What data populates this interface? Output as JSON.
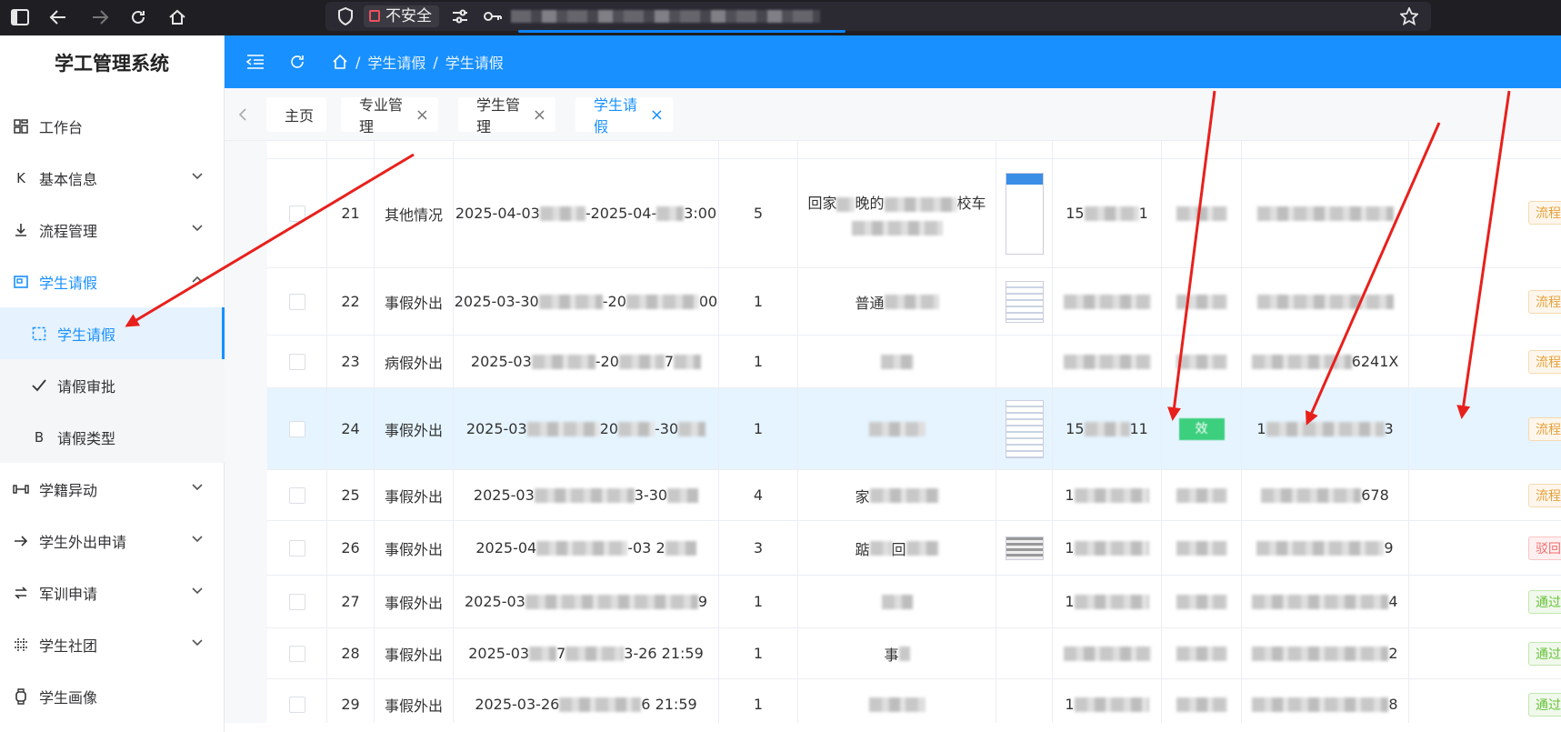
{
  "browser": {
    "security_label": "不安全"
  },
  "sidebar": {
    "app_title": "学工管理系统",
    "items": [
      {
        "label": "工作台"
      },
      {
        "label": "基本信息"
      },
      {
        "label": "流程管理"
      },
      {
        "label": "学生请假"
      },
      {
        "label": "学生请假"
      },
      {
        "label": "请假审批"
      },
      {
        "label": "请假类型"
      },
      {
        "label": "学籍异动"
      },
      {
        "label": "学生外出申请"
      },
      {
        "label": "军训申请"
      },
      {
        "label": "学生社团"
      },
      {
        "label": "学生画像"
      }
    ]
  },
  "header": {
    "breadcrumb": [
      "学生请假",
      "学生请假"
    ],
    "breadcrumb_sep": "/"
  },
  "tabs": [
    {
      "label": "主页"
    },
    {
      "label": "专业管理",
      "close": "×"
    },
    {
      "label": "学生管理",
      "close": "×"
    },
    {
      "label": "学生请假",
      "close": "×"
    }
  ],
  "table": {
    "rows": [
      {
        "no": "21",
        "type": "其他情况",
        "time_a": "2025-04-03",
        "time_b": "-2025-04-",
        "time_c": "3:00",
        "days": "5",
        "reason": "回家",
        "reason2": "晚的",
        "reason3": "校车",
        "phone": "15",
        "phone2": "1",
        "id_tail": "",
        "tag": "流程"
      },
      {
        "no": "22",
        "type": "事假外出",
        "time_a": "2025-03-30",
        "time_b": "-20",
        "time_c": "00",
        "days": "1",
        "reason": "普通",
        "reason2": "",
        "reason3": "",
        "phone": "",
        "phone2": "",
        "id_tail": "",
        "tag": "流程"
      },
      {
        "no": "23",
        "type": "病假外出",
        "time_a": "2025-03",
        "time_b": "-20",
        "time_c": "7",
        "days": "1",
        "reason": "",
        "reason2": "",
        "reason3": "",
        "phone": "",
        "phone2": "",
        "id_tail": "6241X",
        "tag": "流程"
      },
      {
        "no": "24",
        "type": "事假外出",
        "time_a": "2025-03",
        "time_b": "20",
        "time_c": "-30",
        "days": "1",
        "reason": "",
        "reason2": "",
        "reason3": "",
        "phone": "15",
        "phone2": "11",
        "id_tail": "3",
        "id_head": "1",
        "tag": "流程",
        "badge": "效"
      },
      {
        "no": "25",
        "type": "事假外出",
        "time_a": "2025-03",
        "time_b": "3-30",
        "time_c": "",
        "days": "4",
        "reason": "家",
        "reason2": "",
        "reason3": "",
        "phone": "1",
        "phone2": "",
        "id_tail": "678",
        "tag": "流程"
      },
      {
        "no": "26",
        "type": "事假外出",
        "time_a": "2025-04",
        "time_b": "-03 2",
        "time_c": "",
        "days": "3",
        "reason": "踮",
        "reason2": "回",
        "reason3": "",
        "phone": "1",
        "phone2": "",
        "id_tail": "9",
        "tag": "驳回"
      },
      {
        "no": "27",
        "type": "事假外出",
        "time_a": "2025-03",
        "time_b": "9",
        "time_c": "",
        "days": "1",
        "reason": "",
        "reason2": "",
        "reason3": "",
        "phone": "1",
        "phone2": "",
        "id_tail": "4",
        "tag": "通过"
      },
      {
        "no": "28",
        "type": "事假外出",
        "time_a": "2025-03",
        "time_b": "7",
        "time_c": "3-26 21:59",
        "days": "1",
        "reason": "事",
        "reason2": "",
        "reason3": "",
        "phone": "",
        "phone2": "",
        "id_tail": "2",
        "tag": "通过"
      },
      {
        "no": "29",
        "type": "事假外出",
        "time_a": "2025-03-26",
        "time_b": "",
        "time_c": "6 21:59",
        "days": "1",
        "reason": "",
        "reason2": "",
        "reason3": "",
        "phone": "1",
        "phone2": "",
        "id_tail": "8",
        "tag": "通过"
      }
    ]
  },
  "colors": {
    "primary": "#1890ff",
    "annotation_arrow": "#e8201c"
  }
}
